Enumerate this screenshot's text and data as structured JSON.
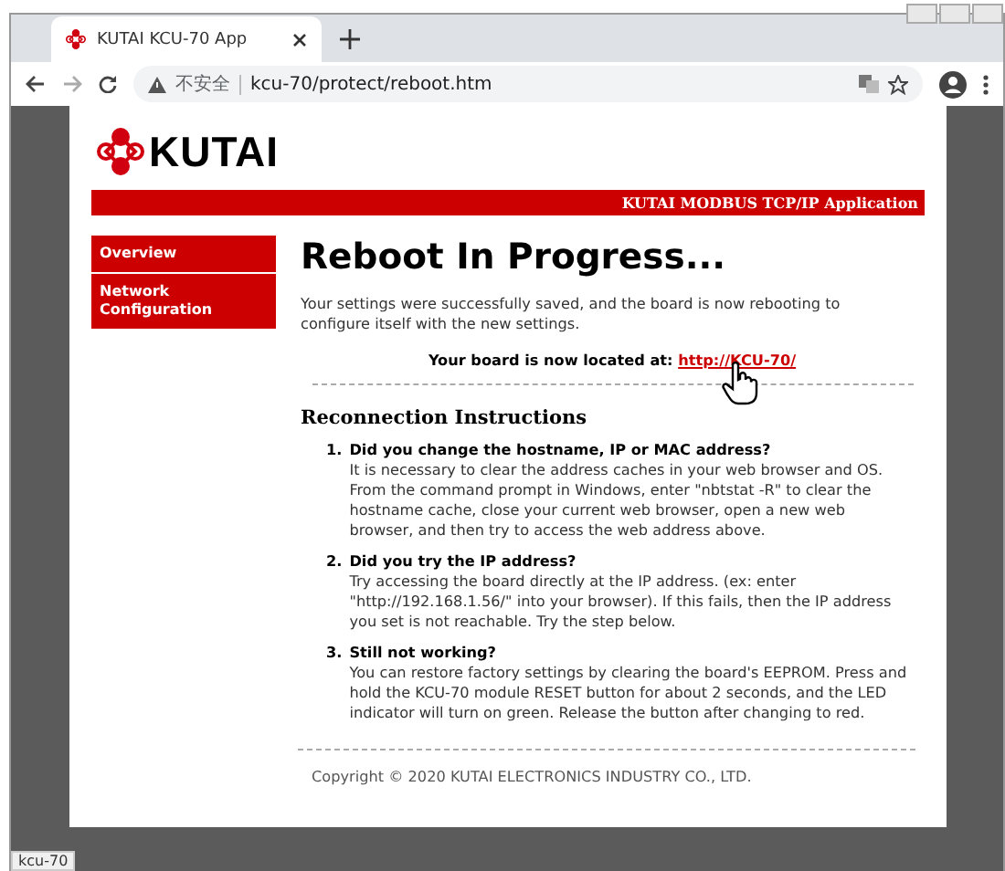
{
  "browser": {
    "tab_title": "KUTAI KCU-70 App",
    "security": "不安全",
    "url": "kcu-70/protect/reboot.htm",
    "status": "kcu-70"
  },
  "page": {
    "logo": "KUTAI",
    "banner": "KUTAI MODBUS TCP/IP Application",
    "sidebar": [
      {
        "label": "Overview"
      },
      {
        "label": "Network Configuration"
      }
    ],
    "title": "Reboot In Progress...",
    "message": "Your settings were successfully saved, and the board is now rebooting to configure itself with the new settings.",
    "location_label": "Your board is now located at:",
    "location_link": "http://KCU-70/",
    "section_title": "Reconnection Instructions",
    "steps": [
      {
        "number": "1.",
        "title": "Did you change the hostname, IP or MAC address?",
        "text": "It is necessary to clear the address caches in your web browser and OS. From the command prompt in Windows, enter \"nbtstat -R\" to clear the hostname cache, close your current web browser, open a new web browser, and then try to access the web address above."
      },
      {
        "number": "2.",
        "title": "Did you try the IP address?",
        "text": "Try accessing the board directly at the IP address. (ex: enter \"http://192.168.1.56/\" into your browser). If this fails, then the IP address you set is not reachable. Try the step below."
      },
      {
        "number": "3.",
        "title": "Still not working?",
        "text": "You can restore factory settings by clearing the board's EEPROM. Press and hold the KCU-70 module RESET button for about 2 seconds, and the LED indicator will turn on green. Release the button after changing to red."
      }
    ],
    "copyright": "Copyright © 2020 KUTAI ELECTRONICS INDUSTRY CO., LTD."
  }
}
